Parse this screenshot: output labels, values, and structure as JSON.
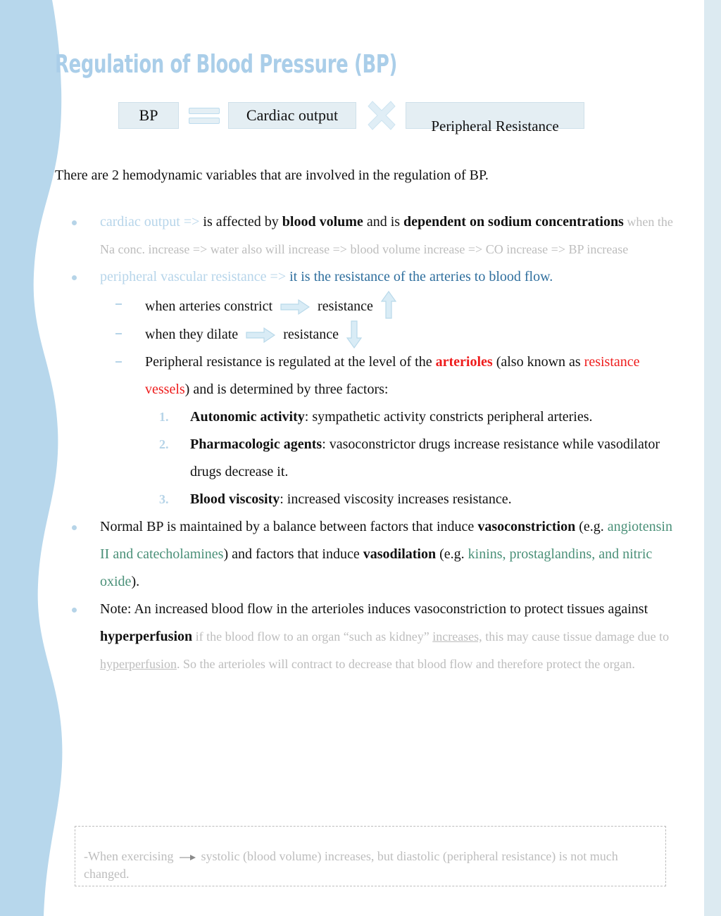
{
  "page": {
    "title": "Regulation of Blood Pressure (BP)",
    "colors": {
      "title_blue": "#aacee9",
      "light_blue": "#b7d5ea",
      "steel_blue": "#2f6f9e",
      "red": "#ee1c1c",
      "teal": "#4a9078",
      "gray": "#bdbdbd",
      "box_fill": "#e4eef3",
      "edge_blue": "#b7d7ec",
      "right_strip": "#dceaf1"
    }
  },
  "diagram": {
    "bp_label": "BP",
    "equals_symbol": "=",
    "cardiac_output_label": "Cardiac output",
    "times_symbol": "×",
    "peripheral_resistance_label": "Peripheral Resistance"
  },
  "intro": "There are 2 hemodynamic variables that are involved in the regulation of BP.",
  "bullets": {
    "cardiac_output": {
      "term": "cardiac output",
      "arrow": "=>",
      "text_1": " is affected by ",
      "bold_1": "blood volume",
      "text_2": " and is ",
      "bold_2": "dependent on sodium concentrations",
      "annotation": " when the Na conc. increase => water also will increase => blood volume increase => CO increase => BP increase"
    },
    "pvr": {
      "term": "peripheral vascular resistance",
      "arrow": "=>",
      "definition": " it is the resistance of the arteries to blood flow.",
      "sub": {
        "constrict_pre": " when arteries constrict",
        "constrict_post": "resistance",
        "dilate_pre": "when they dilate",
        "dilate_post": "resistance",
        "regulated_1": "Peripheral resistance is regulated at the level of the ",
        "arterioles": "arterioles",
        "regulated_2": " (also known as ",
        "resistance_vessels": "resistance vessels",
        "regulated_3": ") and is determined by three factors:"
      },
      "factors": [
        {
          "number": "1.",
          "bold": "Autonomic activity",
          "text": ": sympathetic activity constricts peripheral arteries."
        },
        {
          "number": "2.",
          "bold": "Pharmacologic agents",
          "text": ": vasoconstrictor drugs increase resistance while vasodilator drugs decrease it."
        },
        {
          "number": "3.",
          "bold": "Blood viscosity",
          "text": ": increased viscosity increases resistance."
        }
      ]
    },
    "balance": {
      "text_1": "Normal BP is maintained by a balance between factors that induce ",
      "bold_1": "vasoconstriction",
      "text_2": " (e.g. ",
      "teal_1": "angiotensin II and catecholamines",
      "text_3": ") and factors that induce ",
      "bold_2": "vasodilation",
      "text_4": " (e.g. ",
      "teal_2": "kinins, prostaglandins, and nitric oxide",
      "text_5": ")."
    },
    "note": {
      "text_1": "Note: An increased blood flow in the arterioles induces vasoconstriction to protect tissues against ",
      "bold_1": "hyperperfusion",
      "annotation_1": " if the blood flow to an organ “such as kidney” ",
      "underline_1": "increases,",
      "annotation_2": " this may cause tissue damage due to ",
      "underline_2": "hyperperfusion",
      "annotation_3": ". So the arterioles will contract to decrease that blood flow and therefore protect the organ."
    }
  },
  "footer_note": {
    "text_1": "-When exercising",
    "arrow": "→",
    "text_2": "systolic (blood volume) increases, but diastolic (peripheral resistance) is not much changed."
  }
}
